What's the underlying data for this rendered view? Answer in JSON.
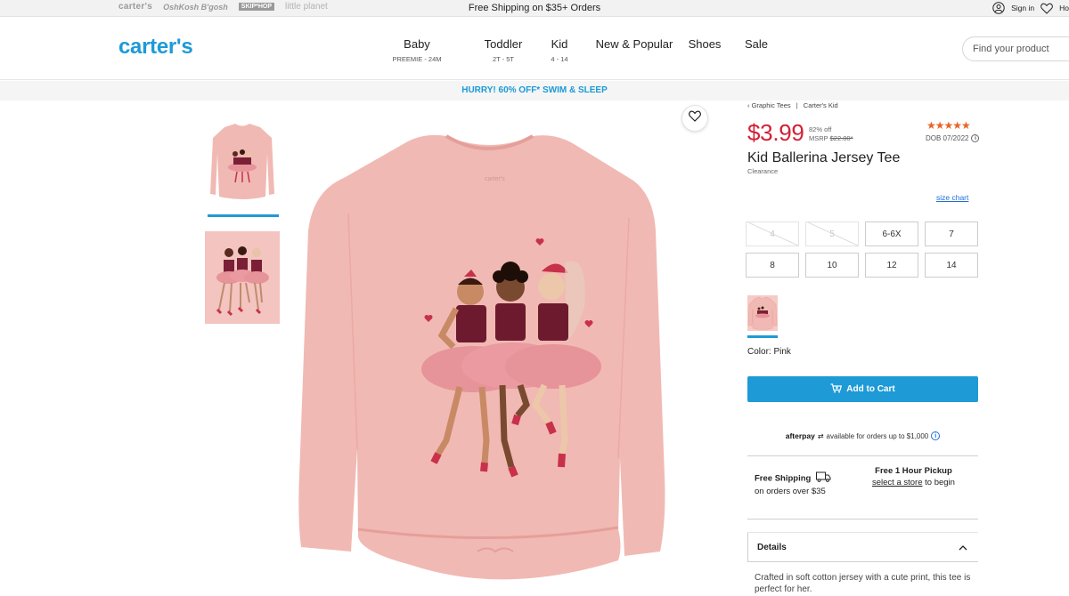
{
  "utility_bar": {
    "brands": [
      "carter's",
      "OshKosh B'gosh",
      "SKIP*HOP",
      "little planet"
    ],
    "promo": "Free Shipping on $35+ Orders",
    "signin_label": "Sign in",
    "help_label": "Ho"
  },
  "header": {
    "logo": "carter's",
    "nav": [
      {
        "label": "Baby",
        "sub": "PREEMIE - 24M"
      },
      {
        "label": "Toddler",
        "sub": "2T - 5T"
      },
      {
        "label": "Kid",
        "sub": "4 - 14"
      },
      {
        "label": "New & Popular",
        "sub": ""
      },
      {
        "label": "Shoes",
        "sub": ""
      },
      {
        "label": "Sale",
        "sub": ""
      }
    ],
    "search_placeholder": "Find your product"
  },
  "promo_strip": "HURRY! 60% OFF* SWIM & SLEEP",
  "breadcrumb": {
    "back": "‹ Graphic Tees",
    "separator": "|",
    "brand": "Carter's  Kid"
  },
  "product": {
    "price": "$3.99",
    "discount": "82% off",
    "msrp_label": "MSRP",
    "msrp": "$22.00*",
    "rating_stars": "★★★★★",
    "rating_value": 5,
    "dob": "DOB 07/2022",
    "title": "Kid Ballerina Jersey Tee",
    "subtitle": "Clearance",
    "size_chart": "size chart",
    "sizes": [
      {
        "label": "4",
        "available": false
      },
      {
        "label": "5",
        "available": false
      },
      {
        "label": "6-6X",
        "available": true
      },
      {
        "label": "7",
        "available": true
      },
      {
        "label": "8",
        "available": true
      },
      {
        "label": "10",
        "available": true
      },
      {
        "label": "12",
        "available": true
      },
      {
        "label": "14",
        "available": true
      }
    ],
    "color_label": "Color: Pink",
    "add_to_cart": "Add to Cart",
    "afterpay_logo": "afterpay",
    "afterpay_text": "available for orders up to $1,000",
    "shipping_title": "Free Shipping",
    "shipping_sub": "on orders over $35",
    "pickup_title": "Free 1 Hour Pickup",
    "pickup_link": "select a store",
    "pickup_suffix": " to begin",
    "details_label": "Details",
    "description": "Crafted in soft cotton jersey with a cute print, this tee is perfect for her."
  },
  "colors": {
    "brand_blue": "#1e9ad6",
    "price_red": "#d31f35",
    "shirt_pink": "#f1b9b3",
    "star_orange": "#e8642a"
  },
  "icons": [
    "user-icon",
    "heart-icon",
    "search-icon",
    "info-icon",
    "truck-icon",
    "cart-icon",
    "chevron-up-icon"
  ]
}
